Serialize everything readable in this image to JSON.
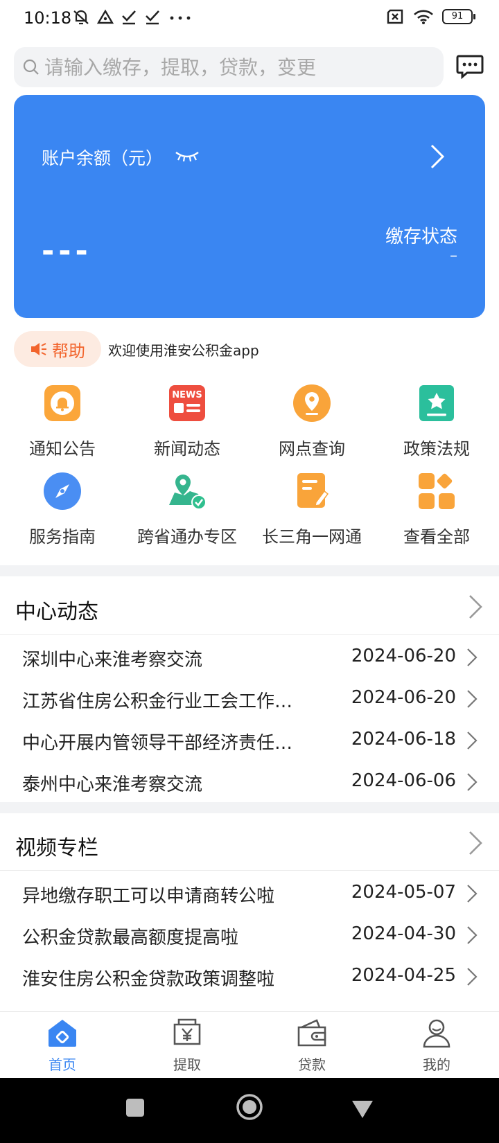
{
  "status_bar": {
    "time": "10:18",
    "battery": "91"
  },
  "search": {
    "placeholder": "请输入缴存，提取，贷款，变更"
  },
  "account_card": {
    "label": "账户余额（元）",
    "balance": "---",
    "status_label": "缴存状态",
    "status_value": "–"
  },
  "notice": {
    "help_label": "帮助",
    "text": "欢迎使用淮安公积金app"
  },
  "grid": [
    {
      "label": "通知公告",
      "icon": "bell-icon"
    },
    {
      "label": "新闻动态",
      "icon": "news-icon"
    },
    {
      "label": "网点查询",
      "icon": "location-pin-icon"
    },
    {
      "label": "政策法规",
      "icon": "star-book-icon"
    },
    {
      "label": "服务指南",
      "icon": "compass-icon"
    },
    {
      "label": "跨省通办专区",
      "icon": "map-check-icon"
    },
    {
      "label": "长三角一网通",
      "icon": "document-edit-icon"
    },
    {
      "label": "查看全部",
      "icon": "grid-all-icon"
    }
  ],
  "news_icon_text": "NEWS",
  "center_news": {
    "title": "中心动态",
    "items": [
      {
        "title": "深圳中心来淮考察交流",
        "date": "2024-06-20"
      },
      {
        "title": "江苏省住房公积金行业工会工作…",
        "date": "2024-06-20"
      },
      {
        "title": "中心开展内管领导干部经济责任…",
        "date": "2024-06-18"
      },
      {
        "title": "泰州中心来淮考察交流",
        "date": "2024-06-06"
      }
    ]
  },
  "video_column": {
    "title": "视频专栏",
    "items": [
      {
        "title": "异地缴存职工可以申请商转公啦",
        "date": "2024-05-07"
      },
      {
        "title": "公积金贷款最高额度提高啦",
        "date": "2024-04-30"
      },
      {
        "title": "淮安住房公积金贷款政策调整啦",
        "date": "2024-04-25"
      }
    ]
  },
  "tabs": [
    {
      "label": "首页",
      "icon": "home-icon",
      "active": true
    },
    {
      "label": "提取",
      "icon": "withdraw-icon",
      "active": false
    },
    {
      "label": "贷款",
      "icon": "wallet-icon",
      "active": false
    },
    {
      "label": "我的",
      "icon": "profile-icon",
      "active": false
    }
  ],
  "colors": {
    "primary": "#3a86f2",
    "help": "#f2642c",
    "background_gray": "#f2f3f5"
  }
}
